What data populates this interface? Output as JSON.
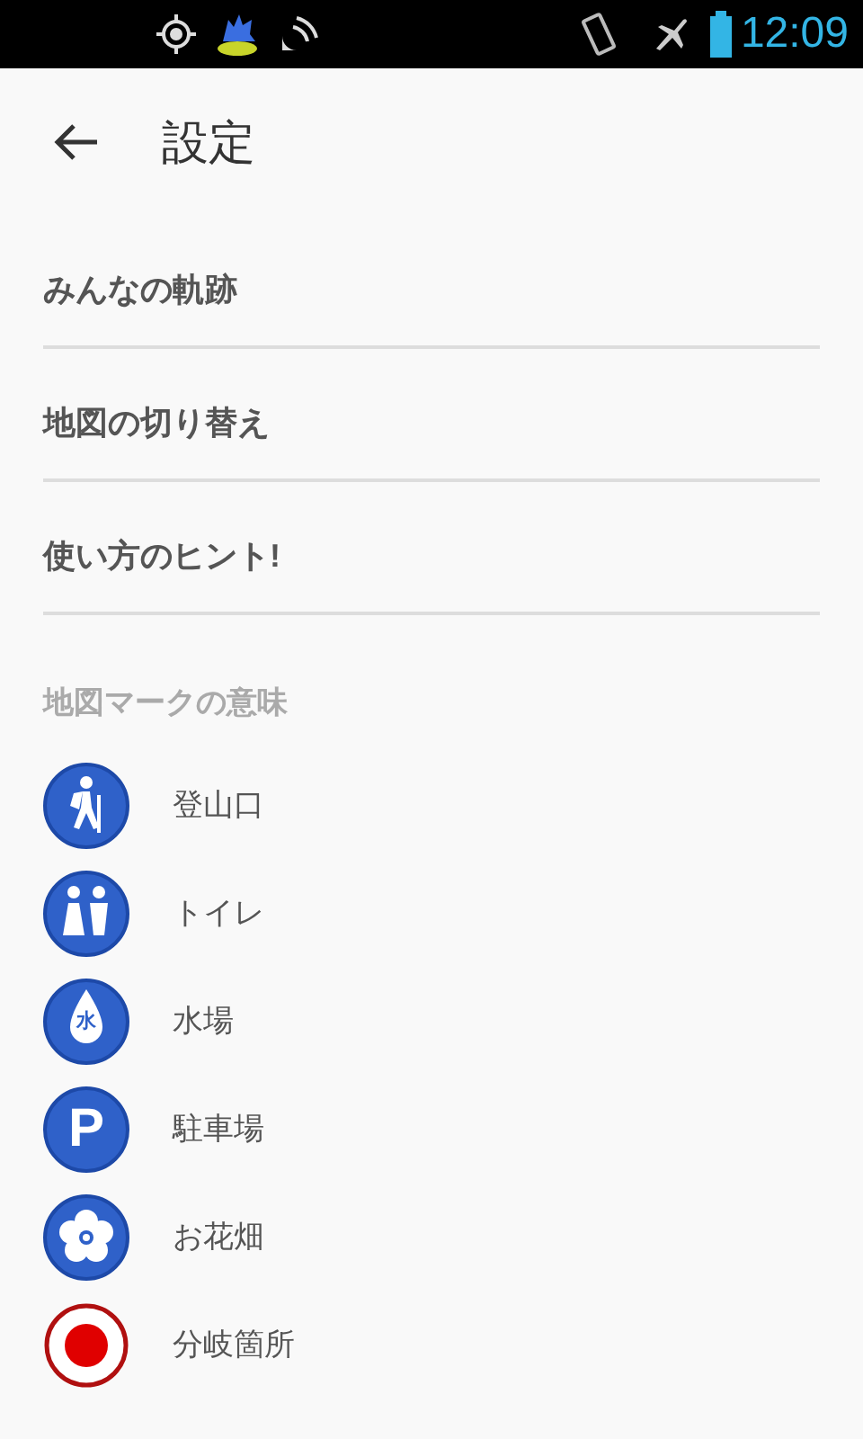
{
  "status_bar": {
    "time": "12:09"
  },
  "header": {
    "title": "設定"
  },
  "menu_items": [
    {
      "label": "みんなの軌跡"
    },
    {
      "label": "地図の切り替え"
    },
    {
      "label": "使い方のヒント!"
    }
  ],
  "legend": {
    "heading": "地図マークの意味",
    "items": [
      {
        "kind": "hiker",
        "label": "登山口"
      },
      {
        "kind": "toilet",
        "label": "トイレ"
      },
      {
        "kind": "water",
        "glyph": "水",
        "label": "水場"
      },
      {
        "kind": "parking",
        "glyph": "P",
        "label": "駐車場"
      },
      {
        "kind": "flower",
        "label": "お花畑"
      },
      {
        "kind": "junction",
        "label": "分岐箇所"
      }
    ]
  }
}
